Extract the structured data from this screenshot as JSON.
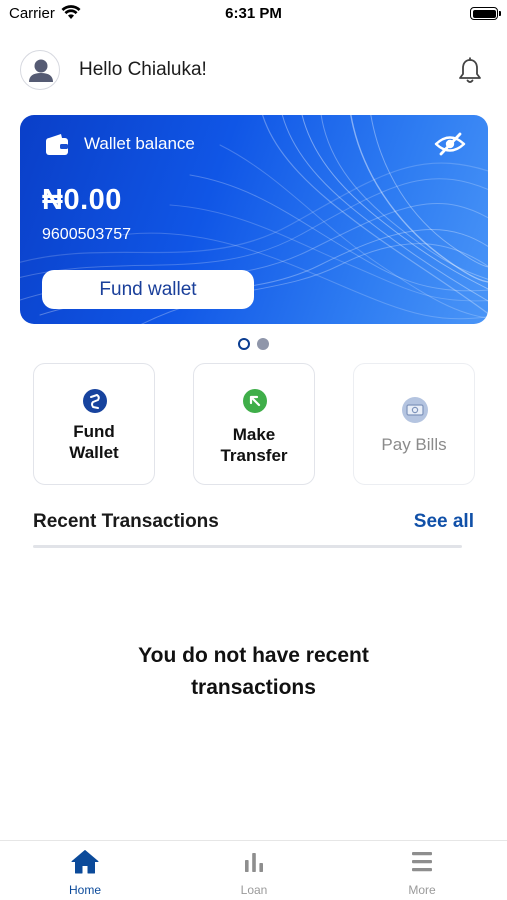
{
  "status_bar": {
    "carrier": "Carrier",
    "time": "6:31 PM"
  },
  "header": {
    "greeting": "Hello Chialuka!"
  },
  "wallet": {
    "label": "Wallet balance",
    "balance": "₦0.00",
    "account_number": "9600503757",
    "fund_button": "Fund wallet"
  },
  "carousel": {
    "pages": 2,
    "active_index": 0
  },
  "actions": [
    {
      "line1": "Fund",
      "line2": "Wallet",
      "icon": "fund-wallet-icon",
      "enabled": true
    },
    {
      "line1": "Make",
      "line2": "Transfer",
      "icon": "transfer-arrow-icon",
      "enabled": true
    },
    {
      "line1": "Pay Bills",
      "line2": "",
      "icon": "bill-icon",
      "enabled": false
    }
  ],
  "recent": {
    "title": "Recent Transactions",
    "see_all": "See all",
    "empty_line1": "You do not have recent",
    "empty_line2": "transactions"
  },
  "tabs": [
    {
      "label": "Home",
      "icon": "home-icon",
      "active": true
    },
    {
      "label": "Loan",
      "icon": "bar-chart-icon",
      "active": false
    },
    {
      "label": "More",
      "icon": "menu-icon",
      "active": false
    }
  ],
  "colors": {
    "brand_blue": "#0b4a9a",
    "card_gradient_start": "#0a3fc8",
    "card_gradient_end": "#4a95f7",
    "transfer_green": "#3fae49"
  }
}
